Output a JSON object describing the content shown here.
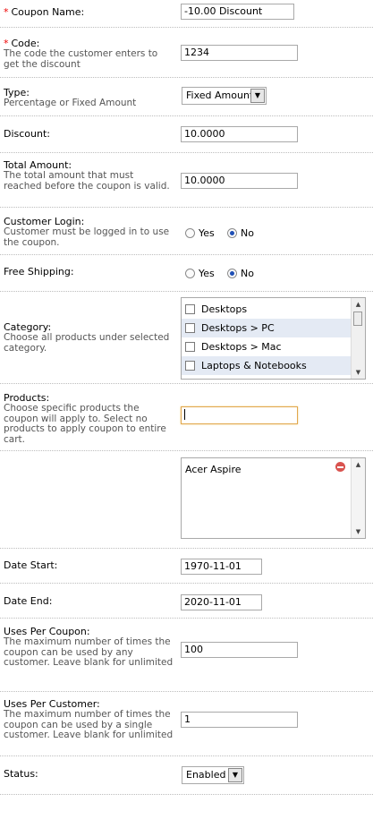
{
  "coupon_name": {
    "label": "Coupon Name:",
    "required_mark": "*",
    "value": "-10.00 Discount"
  },
  "code": {
    "label": "Code:",
    "required_mark": "*",
    "help": "The code the customer enters to get the discount",
    "value": "1234"
  },
  "type": {
    "label": "Type:",
    "help": "Percentage or Fixed Amount",
    "selected": "Fixed Amount"
  },
  "discount": {
    "label": "Discount:",
    "value": "10.0000"
  },
  "total_amount": {
    "label": "Total Amount:",
    "help": "The total amount that must reached before the coupon is valid.",
    "value": "10.0000"
  },
  "customer_login": {
    "label": "Customer Login:",
    "help": "Customer must be logged in to use the coupon.",
    "yes": "Yes",
    "no": "No",
    "selected": "No"
  },
  "free_shipping": {
    "label": "Free Shipping:",
    "yes": "Yes",
    "no": "No",
    "selected": "No"
  },
  "category": {
    "label": "Category:",
    "help": "Choose all products under selected category.",
    "items": [
      {
        "label": "Desktops",
        "checked": false
      },
      {
        "label": "Desktops > PC",
        "checked": false
      },
      {
        "label": "Desktops > Mac",
        "checked": false
      },
      {
        "label": "Laptops & Notebooks",
        "checked": false
      }
    ]
  },
  "products": {
    "label": "Products:",
    "help": "Choose specific products the coupon will apply to. Select no products to apply coupon to entire cart.",
    "search_value": "",
    "selected_items": [
      "Acer Aspire"
    ]
  },
  "date_start": {
    "label": "Date Start:",
    "value": "1970-11-01"
  },
  "date_end": {
    "label": "Date End:",
    "value": "2020-11-01"
  },
  "uses_per_coupon": {
    "label": "Uses Per Coupon:",
    "help": "The maximum number of times the coupon can be used by any customer. Leave blank for unlimited",
    "value": "100"
  },
  "uses_per_customer": {
    "label": "Uses Per Customer:",
    "help": "The maximum number of times the coupon can be used by a single customer. Leave blank for unlimited",
    "value": "1"
  },
  "status": {
    "label": "Status:",
    "selected": "Enabled"
  },
  "colors": {
    "required": "#ee0000",
    "focus_border": "#e1a84d",
    "radio_selected": "#1f4fb5",
    "list_highlight": "#e4eaf4",
    "remove": "#d9534f"
  }
}
